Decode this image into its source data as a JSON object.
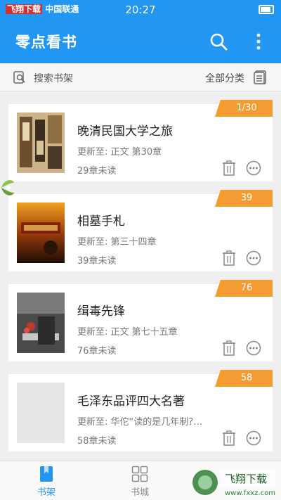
{
  "status_bar": {
    "carrier_watermark": "飞翔下载",
    "carrier_watermark_url": "www.FXXZ.com",
    "carrier": "中国联通",
    "time": "20:27"
  },
  "app_bar": {
    "title": "零点看书",
    "search_icon": "search-icon",
    "more_icon": "more-vertical-icon"
  },
  "toolbar": {
    "search_label": "搜索书架",
    "category_label": "全部分类"
  },
  "books": [
    {
      "title": "晚清民国大学之旅",
      "update": "更新至: 正文 第30章",
      "unread": "29章未读",
      "badge": "1/30",
      "cover": "cover-1"
    },
    {
      "title": "相墓手札",
      "update": "更新至: 第三十四章",
      "unread": "39章未读",
      "badge": "39",
      "cover": "cover-2"
    },
    {
      "title": "缉毒先锋",
      "update": "更新至: 正文 第七十五章",
      "unread": "76章未读",
      "badge": "76",
      "cover": "cover-3"
    },
    {
      "title": "毛泽东品评四大名著",
      "update": "更新至: 华佗“读的是几年制?…",
      "unread": "58章未读",
      "badge": "58",
      "cover": "blank"
    }
  ],
  "bottom_nav": [
    {
      "label": "书架",
      "active": true
    },
    {
      "label": "书城",
      "active": false
    }
  ],
  "colors": {
    "primary": "#2196f3",
    "badge": "#f39c32"
  },
  "watermark": {
    "text": "飞翔下载",
    "url": "www.fxxz.com"
  }
}
